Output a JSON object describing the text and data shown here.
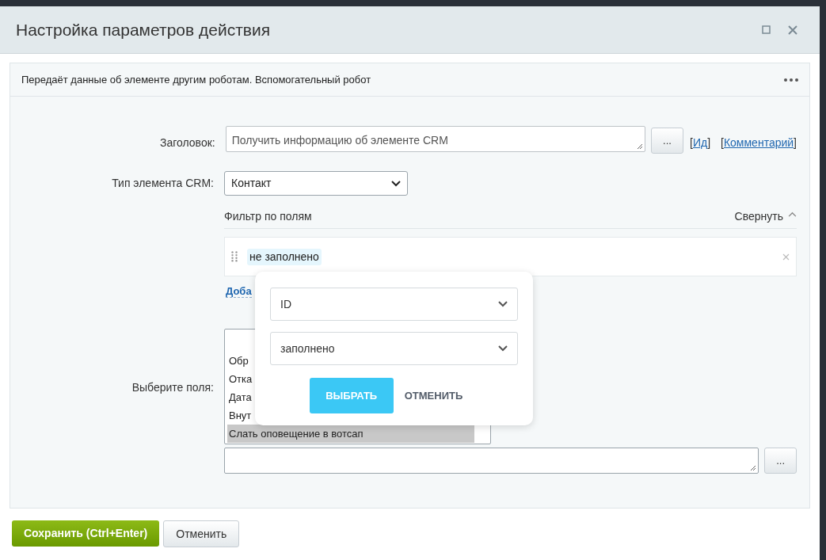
{
  "dialog": {
    "title": "Настройка параметров действия"
  },
  "panel": {
    "description": "Передаёт данные об элементе другим роботам. Вспомогательный робот"
  },
  "title_field": {
    "label": "Заголовок:",
    "value": "Получить информацию об элементе CRM",
    "button": "...",
    "links": [
      {
        "open": "[",
        "text": "Ид",
        "close": "]"
      },
      {
        "open": "[",
        "text": "Комментарий",
        "close": "]"
      }
    ]
  },
  "type_field": {
    "label": "Тип элемента CRM:",
    "value": "Контакт"
  },
  "filter": {
    "heading": "Фильтр по полям",
    "collapse": "Свернуть",
    "chip": "не заполнено",
    "add_link": "Доба"
  },
  "fields": {
    "label": "Выберите поля:",
    "items": [
      {
        "text": "Обр",
        "selected": false
      },
      {
        "text": "Отка",
        "selected": false
      },
      {
        "text": "Дата",
        "selected": false
      },
      {
        "text": "Внут",
        "selected": false
      },
      {
        "text": "Слать оповещение в вотсап",
        "selected": true
      }
    ],
    "button": "..."
  },
  "popup": {
    "field": "ID",
    "condition": "заполнено",
    "confirm": "ВЫБРАТЬ",
    "cancel": "ОТМЕНИТЬ"
  },
  "footer": {
    "save": "Сохранить (Ctrl+Enter)",
    "cancel": "Отменить"
  }
}
